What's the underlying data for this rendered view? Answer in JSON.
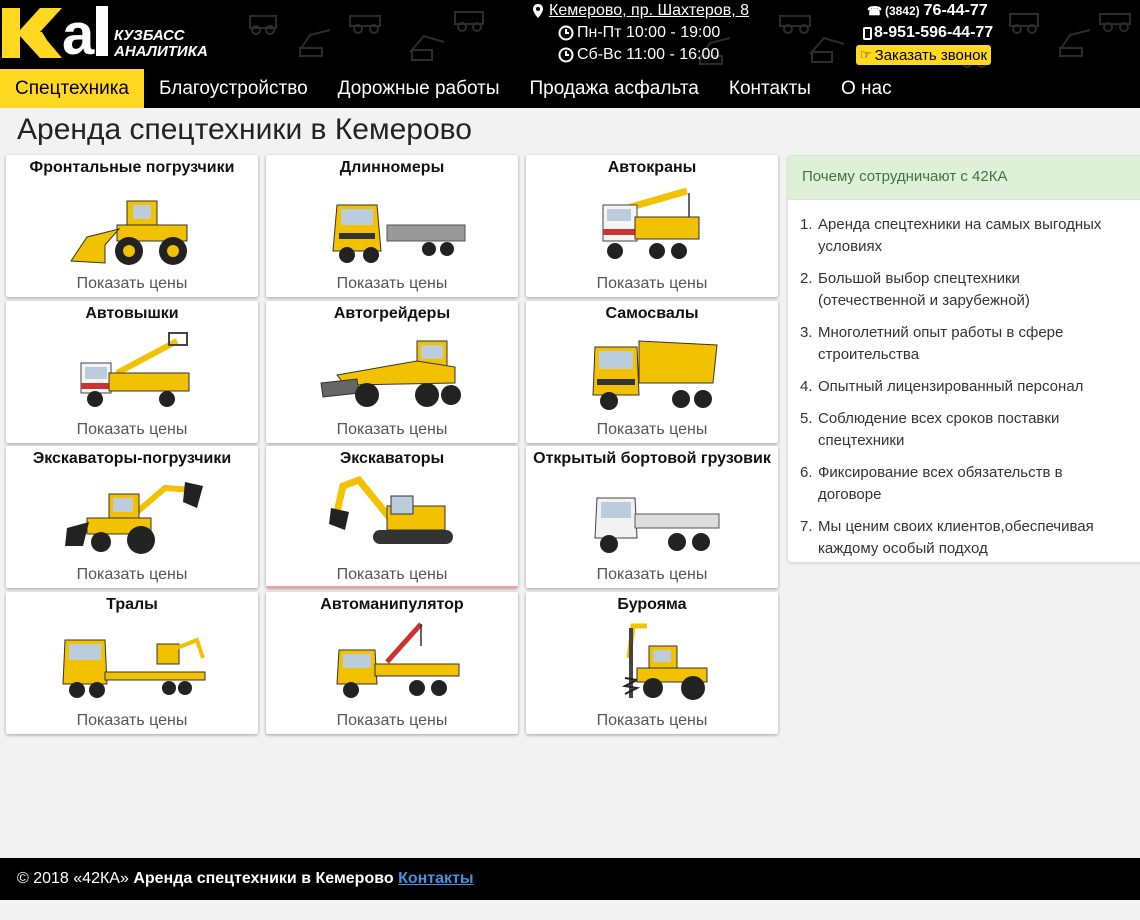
{
  "brand": {
    "name_line1": "КУЗБАСС",
    "name_line2": "АНАЛИТИКА",
    "accent": "#ffd81f"
  },
  "header": {
    "address": "Кемерово, пр. Шахтеров, 8",
    "hours_weekdays": "Пн-Пт 10:00 - 19:00",
    "hours_weekend": "Сб-Вс 11:00 - 16:00",
    "phone_code": "(3842)",
    "phone_main": "76-44-77",
    "phone_mobile": "8-951-596-44-77",
    "callback_label": "Заказать звонок"
  },
  "nav": {
    "items": [
      "Спецтехника",
      "Благоустройство",
      "Дорожные работы",
      "Продажа асфальта",
      "Контакты",
      "О нас"
    ]
  },
  "page_title": "Аренда спецтехники в Кемерово",
  "cards": [
    {
      "name": "Фронтальные погрузчики",
      "price_label": "Показать цены",
      "icon": "front-loader-icon"
    },
    {
      "name": "Длинномеры",
      "price_label": "Показать цены",
      "icon": "long-truck-icon"
    },
    {
      "name": "Автокраны",
      "price_label": "Показать цены",
      "icon": "truck-crane-icon"
    },
    {
      "name": "Автовышки",
      "price_label": "Показать цены",
      "icon": "aerial-platform-icon"
    },
    {
      "name": "Автогрейдеры",
      "price_label": "Показать цены",
      "icon": "motor-grader-icon"
    },
    {
      "name": "Самосвалы",
      "price_label": "Показать цены",
      "icon": "dump-truck-icon"
    },
    {
      "name": "Экскаваторы-погрузчики",
      "price_label": "Показать цены",
      "icon": "backhoe-loader-icon"
    },
    {
      "name": "Экскаваторы",
      "price_label": "Показать цены",
      "icon": "excavator-icon"
    },
    {
      "name": "Открытый бортовой грузовик",
      "price_label": "Показать цены",
      "icon": "flatbed-truck-icon"
    },
    {
      "name": "Тралы",
      "price_label": "Показать цены",
      "icon": "lowbed-trailer-icon"
    },
    {
      "name": "Автоманипулятор",
      "price_label": "Показать цены",
      "icon": "crane-manipulator-icon"
    },
    {
      "name": "Бурояма",
      "price_label": "Показать цены",
      "icon": "pile-driller-icon"
    }
  ],
  "sidebar": {
    "title": "Почему сотрудничают с 42КА",
    "items": [
      "Аренда спецтехники на самых выгодных условиях",
      "Большой выбор спецтехники (отечественной и зарубежной)",
      "Многолетний опыт работы в сфере строительства",
      "Опытный лицензированный персонал",
      "Соблюдение всех сроков поставки спецтехники",
      "Фиксирование всех обязательств в договоре",
      "Мы ценим своих клиентов,обеспечивая каждому особый подход"
    ]
  },
  "footer": {
    "copyright": "© 2018 «42КА»",
    "title": "Аренда спецтехники в Кемерово",
    "link": "Контакты"
  }
}
